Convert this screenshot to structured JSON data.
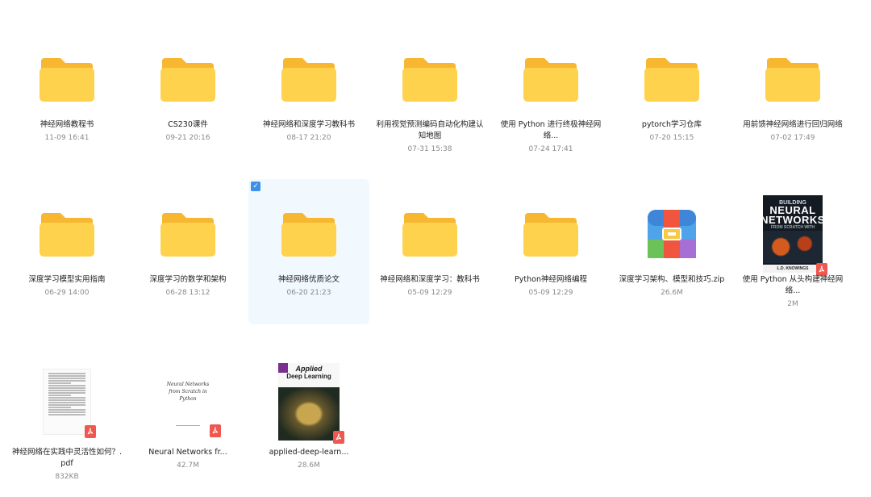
{
  "selected_index": 9,
  "items": [
    {
      "type": "folder",
      "name": "神经网络教程书",
      "meta": "11-09 16:41"
    },
    {
      "type": "folder",
      "name": "CS230课件",
      "meta": "09-21 20:16"
    },
    {
      "type": "folder",
      "name": "神经网络和深度学习教科书",
      "meta": "08-17 21:20"
    },
    {
      "type": "folder",
      "name": "利用视觉预测编码自动化构建认知地图",
      "meta": "07-31 15:38"
    },
    {
      "type": "folder",
      "name": "使用 Python 进行终极神经网络...",
      "meta": "07-24 17:41"
    },
    {
      "type": "folder",
      "name": "pytorch学习仓库",
      "meta": "07-20 15:15"
    },
    {
      "type": "folder",
      "name": "用前馈神经网络进行回归网络",
      "meta": "07-02 17:49"
    },
    {
      "type": "folder",
      "name": "深度学习模型实用指南",
      "meta": "06-29 14:00"
    },
    {
      "type": "folder",
      "name": "深度学习的数学和架构",
      "meta": "06-28 13:12"
    },
    {
      "type": "folder",
      "name": "神经网络优质论文",
      "meta": "06-20 21:23"
    },
    {
      "type": "folder",
      "name": "神经网络和深度学习：教科书",
      "meta": "05-09 12:29"
    },
    {
      "type": "folder",
      "name": "Python神经网络编程",
      "meta": "05-09 12:29"
    },
    {
      "type": "zip",
      "name": "深度学习架构、模型和技巧.zip",
      "meta": "26.6M"
    },
    {
      "type": "pdf-book",
      "name": "使用 Python 从头构建神经网络...",
      "meta": "2M",
      "cover": {
        "l1": "BUILDING",
        "l2": "NEURAL",
        "l3": "NETWORKS",
        "l4": "FROM SCRATCH WITH",
        "l5": "PYTHON",
        "author": "L.D. KNOWINGS"
      }
    },
    {
      "type": "pdf-paper",
      "name": "神经网络在实践中灵活性如何？.pdf",
      "meta": "832KB"
    },
    {
      "type": "pdf-paper2",
      "name": "Neural Networks fr...",
      "meta": "42.7M",
      "cover": {
        "t1": "Neural Networks",
        "t2": "from Scratch in",
        "t3": "Python"
      }
    },
    {
      "type": "pdf-adl",
      "name": "applied-deep-learn...",
      "meta": "28.6M",
      "cover": {
        "a1": "Applied",
        "a2": "Deep Learning"
      }
    }
  ],
  "colors": {
    "folder_body": "#ffd24d",
    "folder_tab": "#f7b731",
    "selected_bg": "#f1f8fe",
    "check": "#3d8fe8",
    "pdf": "#f0574f"
  }
}
